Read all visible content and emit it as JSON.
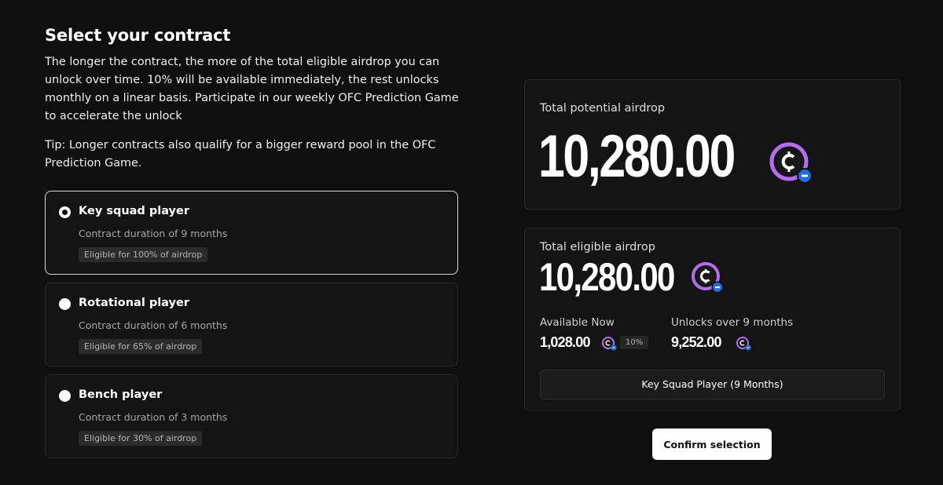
{
  "header": {
    "title": "Select your contract",
    "description": "The longer the contract, the more of the total eligible airdrop you can unlock over time. 10% will be available immediately, the rest unlocks monthly on a linear basis. Participate in our weekly OFC Prediction Game to accelerate the unlock",
    "tip": "Tip: Longer contracts also qualify for a bigger reward pool in the OFC Prediction Game."
  },
  "options": [
    {
      "title": "Key squad player",
      "subtitle": "Contract duration of 9 months",
      "badge": "Eligible for 100% of airdrop",
      "selected": true
    },
    {
      "title": "Rotational player",
      "subtitle": "Contract duration of 6 months",
      "badge": "Eligible for 65% of airdrop",
      "selected": false
    },
    {
      "title": "Bench player",
      "subtitle": "Contract duration of 3 months",
      "badge": "Eligible for 30% of airdrop",
      "selected": false
    }
  ],
  "potential": {
    "label": "Total potential airdrop",
    "value": "10,280.00"
  },
  "eligible": {
    "label": "Total eligible airdrop",
    "value": "10,280.00",
    "available_label": "Available Now",
    "available_value": "1,028.00",
    "available_pct": "10%",
    "unlocks_label": "Unlocks over 9 months",
    "unlocks_value": "9,252.00",
    "selected_contract": "Key Squad Player (9 Months)"
  },
  "confirm_label": "Confirm selection",
  "colors": {
    "background": "#0f0f0f",
    "card": "#141414",
    "coin_ring": "#b56cf0",
    "coin_badge": "#1e6fe0"
  },
  "icons": {
    "token": "token-coin-icon",
    "radio": "radio-icon"
  }
}
